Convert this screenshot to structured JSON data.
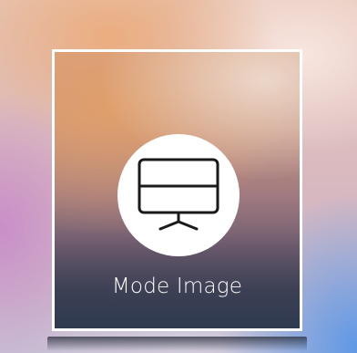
{
  "mode_card": {
    "label": "Mode Image",
    "icon": "monitor-split-icon"
  },
  "colors": {
    "frame": "#ffffff",
    "icon_background": "#ffffff",
    "icon_stroke": "#1a1a1a",
    "label_text": "#ffffff"
  }
}
